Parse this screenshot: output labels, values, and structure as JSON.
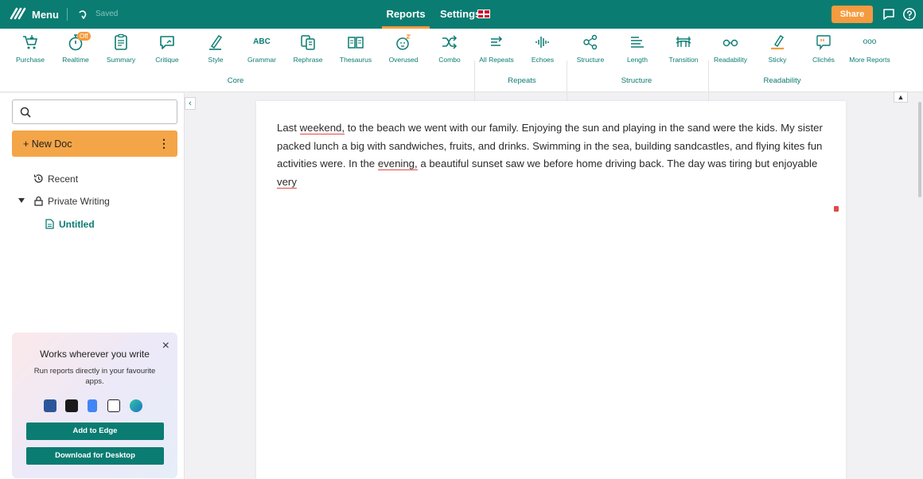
{
  "topbar": {
    "menu_label": "Menu",
    "saved_label": "Saved",
    "reports_label": "Reports",
    "settings_label": "Settings",
    "share_label": "Share",
    "brand_color": "#0b7c72",
    "accent_color": "#f49b3f"
  },
  "toolbar": {
    "tools": [
      {
        "label": "Purchase",
        "icon": "cart-icon"
      },
      {
        "label": "Realtime",
        "icon": "stopwatch-icon",
        "badge": "Off"
      },
      {
        "label": "Summary",
        "icon": "clipboard-icon"
      },
      {
        "label": "Critique",
        "icon": "critique-icon"
      },
      {
        "label": "Style",
        "icon": "pen-icon"
      },
      {
        "label": "Grammar",
        "icon": "abc-icon",
        "glyph": "ABC"
      },
      {
        "label": "Rephrase",
        "icon": "rephrase-icon"
      },
      {
        "label": "Thesaurus",
        "icon": "book-icon"
      },
      {
        "label": "Overused",
        "icon": "sleepy-face-icon"
      },
      {
        "label": "Combo",
        "icon": "shuffle-icon"
      },
      {
        "label": "All Repeats",
        "icon": "repeat-icon"
      },
      {
        "label": "Echoes",
        "icon": "soundwave-icon"
      },
      {
        "label": "Structure",
        "icon": "nodes-icon"
      },
      {
        "label": "Length",
        "icon": "lines-icon"
      },
      {
        "label": "Transition",
        "icon": "bridge-icon"
      },
      {
        "label": "Readability",
        "icon": "glasses-icon"
      },
      {
        "label": "Sticky",
        "icon": "highlighter-icon"
      },
      {
        "label": "Clichés",
        "icon": "speech-quote-icon"
      },
      {
        "label": "More Reports",
        "icon": "more-dots-icon",
        "glyph": "ooo"
      }
    ],
    "groups": [
      {
        "label": "Core"
      },
      {
        "label": "Repeats"
      },
      {
        "label": "Structure"
      },
      {
        "label": "Readability"
      }
    ]
  },
  "sidebar": {
    "new_doc_label": "+ New Doc",
    "more_glyph": "⋮",
    "recent_label": "Recent",
    "private_label": "Private Writing",
    "doc_label": "Untitled",
    "collapse_glyph": "‹"
  },
  "promo": {
    "title": "Works wherever you write",
    "text": "Run reports directly in your favourite apps.",
    "add_button": "Add to Edge",
    "download_button": "Download for Desktop",
    "close_glyph": "×"
  },
  "editor": {
    "segments": [
      {
        "t": "Last ",
        "u": false
      },
      {
        "t": "weekend,",
        "u": true
      },
      {
        "t": " to the beach we went with our family. Enjoying the sun and playing in the sand were the kids. My sister packed lunch a big with sandwiches, fruits, and drinks. Swimming in the sea, building sandcastles, and flying kites fun activities were. In the ",
        "u": false
      },
      {
        "t": "evening,",
        "u": true
      },
      {
        "t": " a beautiful sunset saw we before home driving back. The day was tiring but enjoyable ",
        "u": false
      },
      {
        "t": "very",
        "u": true
      }
    ],
    "underline_color": "#e24a4a"
  }
}
